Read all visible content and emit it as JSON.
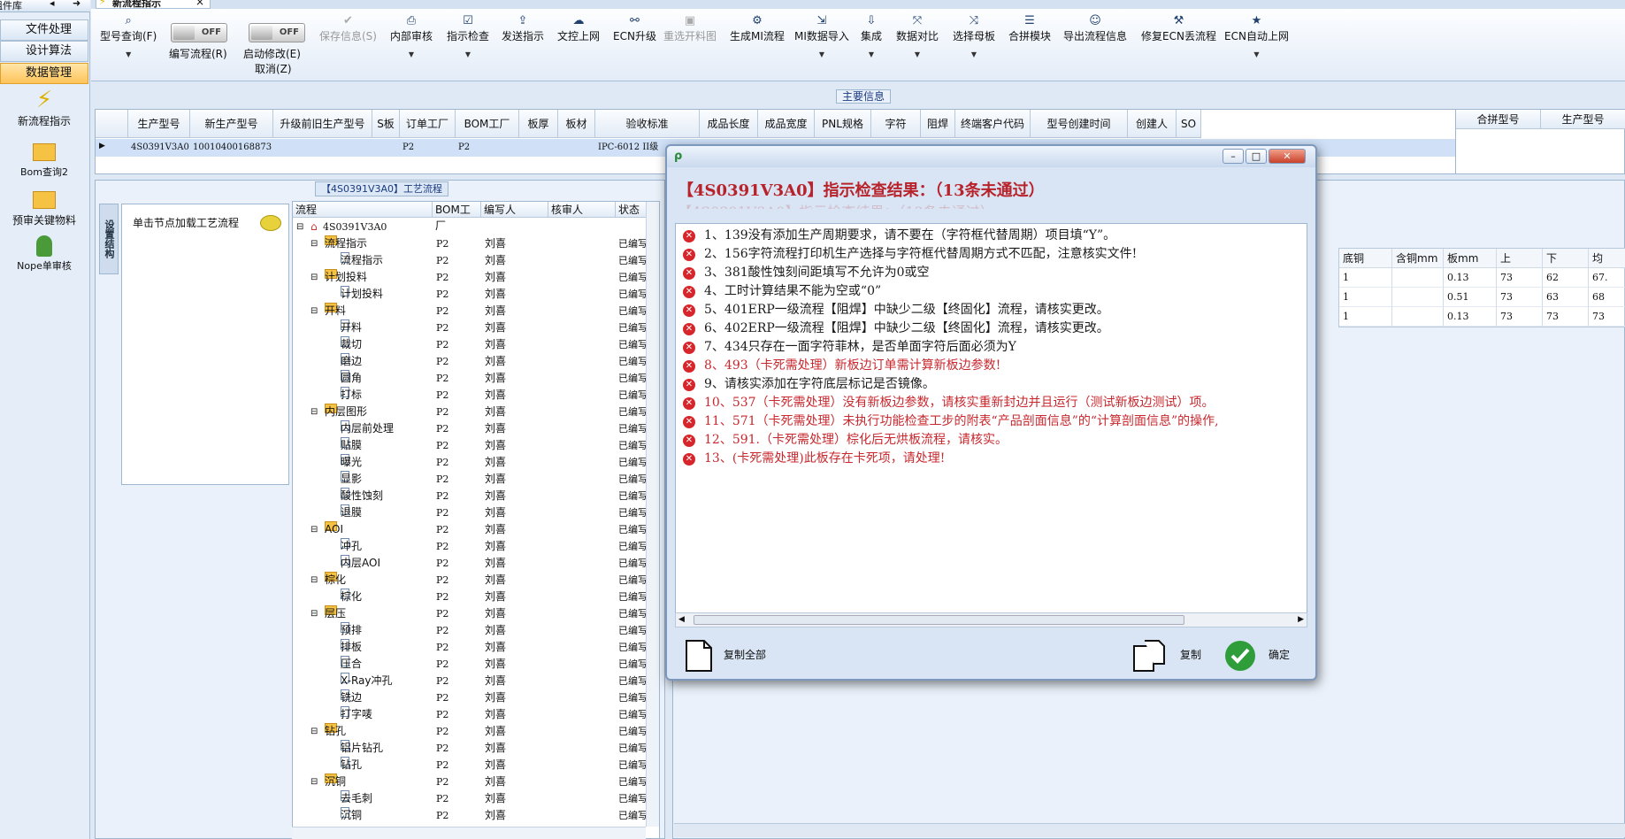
{
  "nav": {
    "header": "组件库",
    "sections": [
      "文件处理",
      "设计算法",
      "数据管理"
    ],
    "active": "数据管理",
    "icons": [
      {
        "label": "新流程指示",
        "icon": "lightning-icon"
      },
      {
        "label": "Bom查询2",
        "icon": "folder-icon"
      },
      {
        "label": "预审关键物料",
        "icon": "folder-icon"
      },
      {
        "label": "Nope单审核",
        "icon": "user-icon"
      }
    ]
  },
  "window_tab": {
    "label": "新流程指示",
    "close": "×"
  },
  "toolbar": {
    "query": "型号查询(F)",
    "write_flow": "编写流程(R)",
    "start_edit": "启动修改(E)",
    "cancel": "取消(Z)",
    "toggle1": "OFF",
    "toggle2": "OFF",
    "save_info": "保存信息(S)",
    "buttons": [
      "内部审核",
      "指示检查",
      "发送指示",
      "文控上网",
      "ECN升级",
      "重选开料图",
      "生成MI流程",
      "MI数据导入",
      "集成",
      "数据对比",
      "选择母板",
      "合拼模块",
      "导出流程信息",
      "修复ECN丢流程",
      "ECN自动上网"
    ]
  },
  "info": {
    "title": "主要信息",
    "headers": [
      "生产型号",
      "新生产型号",
      "升级前旧生产型号",
      "S板",
      "订单工厂",
      "BOM工厂",
      "板厚",
      "板材",
      "验收标准",
      "成品长度",
      "成品宽度",
      "PNL规格",
      "字符",
      "阻焊",
      "终端客户代码",
      "型号创建时间",
      "创建人",
      "SO"
    ],
    "row": {
      "model": "4S0391V3A0",
      "new_model": "10010400168873",
      "order_factory": "P2",
      "bom_factory": "P2",
      "standard": "IPC-6012 II级"
    },
    "right_headers": [
      "合拼型号",
      "生产型号"
    ]
  },
  "process": {
    "title": "【4S0391V3A0】工艺流程",
    "vtab": "设置结构",
    "load_hint": "单击节点加载工艺流程",
    "columns": [
      "流程",
      "BOM工厂",
      "编写人",
      "核审人",
      "状态"
    ],
    "root": "4S0391V3A0",
    "factory": "P2",
    "author": "刘喜",
    "status": "已编写",
    "rows": [
      {
        "name": "流程指示",
        "folder": true
      },
      {
        "name": "流程指示",
        "folder": false
      },
      {
        "name": "计划投料",
        "folder": true
      },
      {
        "name": "计划投料",
        "folder": false
      },
      {
        "name": "开料",
        "folder": true
      },
      {
        "name": "开料",
        "folder": false
      },
      {
        "name": "裁切",
        "folder": false
      },
      {
        "name": "磨边",
        "folder": false
      },
      {
        "name": "圆角",
        "folder": false
      },
      {
        "name": "打标",
        "folder": false
      },
      {
        "name": "内层图形",
        "folder": true
      },
      {
        "name": "内层前处理",
        "folder": false
      },
      {
        "name": "贴膜",
        "folder": false
      },
      {
        "name": "曝光",
        "folder": false
      },
      {
        "name": "显影",
        "folder": false
      },
      {
        "name": "酸性蚀刻",
        "folder": false
      },
      {
        "name": "退膜",
        "folder": false
      },
      {
        "name": "AOI",
        "folder": true
      },
      {
        "name": "冲孔",
        "folder": false
      },
      {
        "name": "内层AOI",
        "folder": false
      },
      {
        "name": "棕化",
        "folder": true
      },
      {
        "name": "棕化",
        "folder": false
      },
      {
        "name": "层压",
        "folder": true
      },
      {
        "name": "预排",
        "folder": false
      },
      {
        "name": "排板",
        "folder": false
      },
      {
        "name": "压合",
        "folder": false
      },
      {
        "name": "X-Ray冲孔",
        "folder": false
      },
      {
        "name": "铣边",
        "folder": false
      },
      {
        "name": "打字唛",
        "folder": false
      },
      {
        "name": "钻孔",
        "folder": true
      },
      {
        "name": "铝片钻孔",
        "folder": false
      },
      {
        "name": "钻孔",
        "folder": false
      },
      {
        "name": "沉铜",
        "folder": true
      },
      {
        "name": "去毛刺",
        "folder": false
      },
      {
        "name": "沉铜",
        "folder": false
      }
    ]
  },
  "right_table": {
    "headers": [
      "底铜",
      "含铜mm",
      "板mm",
      "上",
      "下",
      "均"
    ],
    "rows": [
      [
        "1",
        "",
        "0.13",
        "73",
        "62",
        "67."
      ],
      [
        "1",
        "",
        "0.51",
        "73",
        "63",
        "68"
      ],
      [
        "1",
        "",
        "0.13",
        "73",
        "73",
        "73"
      ]
    ]
  },
  "dialog": {
    "title": "【4S0391V3A0】指示检查结果：（13条未通过）",
    "messages": [
      {
        "text": "1、139没有添加生产周期要求，请不要在（字符框代替周期）项目填“Y”。",
        "red": false
      },
      {
        "text": "2、156字符流程打印机生产选择与字符框代替周期方式不匹配，注意核实文件!",
        "red": false
      },
      {
        "text": "3、381酸性蚀刻间距填写不允许为0或空",
        "red": false
      },
      {
        "text": "4、工时计算结果不能为空或“0”",
        "red": false
      },
      {
        "text": "5、401ERP一级流程【阻焊】中缺少二级【终固化】流程，请核实更改。",
        "red": false
      },
      {
        "text": "6、402ERP一级流程【阻焊】中缺少二级【终固化】流程，请核实更改。",
        "red": false
      },
      {
        "text": "7、434只存在一面字符菲林，是否单面字符后面必须为Y",
        "red": false
      },
      {
        "text": "8、493（卡死需处理）新板边订单需计算新板边参数!",
        "red": true
      },
      {
        "text": "9、请核实添加在字符底层标记是否镜像。",
        "red": false
      },
      {
        "text": "10、537（卡死需处理）没有新板边参数，请核实重新封边并且运行（测试新板边测试）项。",
        "red": true
      },
      {
        "text": "11、571（卡死需处理）未执行功能检查工步的附表“产品剖面信息”的“计算剖面信息”的操作,",
        "red": true
      },
      {
        "text": "12、591.（卡死需处理）棕化后无烘板流程，请核实。",
        "red": true
      },
      {
        "text": "13、(卡死需处理)此板存在卡死项，请处理!",
        "red": true
      }
    ],
    "copy_all": "复制全部",
    "copy": "复制",
    "ok": "确定"
  }
}
